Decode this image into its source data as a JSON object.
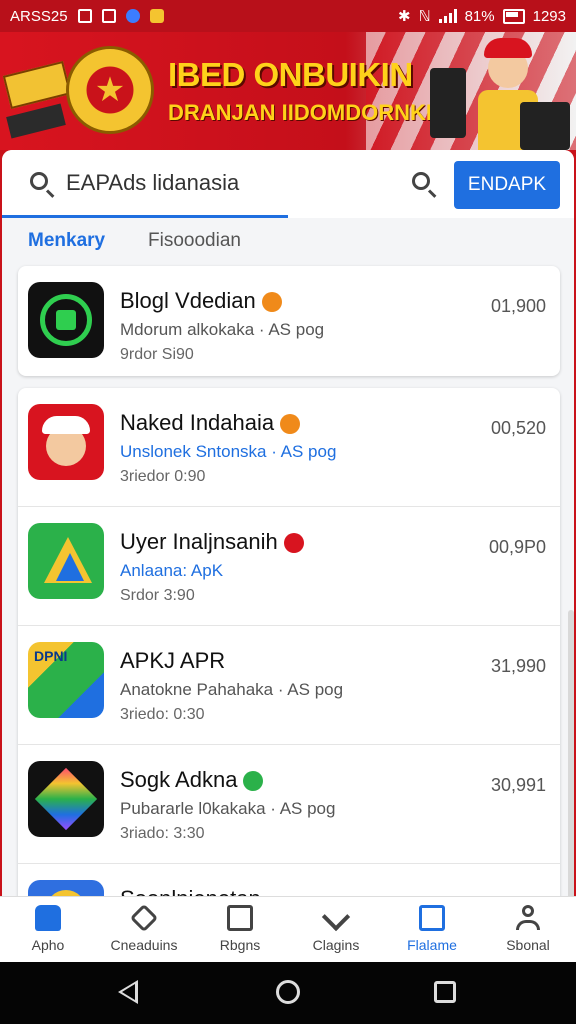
{
  "status_bar": {
    "time_left": "ARSS25",
    "battery": "81%",
    "time_right": "1293"
  },
  "banner": {
    "title": "IBED ONBUIKIN",
    "subtitle": "DRANJAN IIDOMDORNKE"
  },
  "search": {
    "value": "EAPAds lidanasia",
    "button_label": "ENDAPK"
  },
  "tabs": [
    {
      "label": "Menkary",
      "active": true
    },
    {
      "label": "Fisooodian",
      "active": false
    }
  ],
  "apps": [
    {
      "name": "Blogl Vdedian",
      "sub": "Mdorum alkokaka · AS pog",
      "meta": "9rdor Si90",
      "value": "01,900",
      "badge_color": "#f08a1a"
    },
    {
      "name": "Naked Indahaia",
      "sub": "Unslonek Sntonska · AS pog",
      "meta": "3riedor 0:90",
      "value": "00,520",
      "badge_color": "#f08a1a"
    },
    {
      "name": "Uyer Inaljnsanih",
      "sub": "Anlaana: ApK",
      "meta": "Srdor 3:90",
      "value": "00,9P0",
      "badge_color": "#d8141f"
    },
    {
      "name": "APKJ APR",
      "sub": "Anatokne Pahahaka · AS pog",
      "meta": "3riedo: 0:30",
      "value": "31,990",
      "badge_color": ""
    },
    {
      "name": "Sogk Adkna",
      "sub": "Pubararle l0kakaka · AS pog",
      "meta": "3riado: 3:30",
      "value": "30,991",
      "badge_color": "#2bb14a"
    },
    {
      "name": "Soonlnienetan",
      "sub": "",
      "meta": "",
      "value": "",
      "badge_color": ""
    }
  ],
  "bottom_nav": [
    {
      "label": "Apho",
      "icon": "home-icon",
      "active": false
    },
    {
      "label": "Cneaduins",
      "icon": "download-icon",
      "active": false
    },
    {
      "label": "Rbgns",
      "icon": "ranking-icon",
      "active": false
    },
    {
      "label": "Clagins",
      "icon": "category-icon",
      "active": false
    },
    {
      "label": "Flalame",
      "icon": "promo-icon",
      "active": true
    },
    {
      "label": "Sbonal",
      "icon": "account-icon",
      "active": false
    }
  ],
  "colors": {
    "accent": "#1f6fe0",
    "banner_red": "#c9121a",
    "banner_gold": "#ffd21a"
  }
}
